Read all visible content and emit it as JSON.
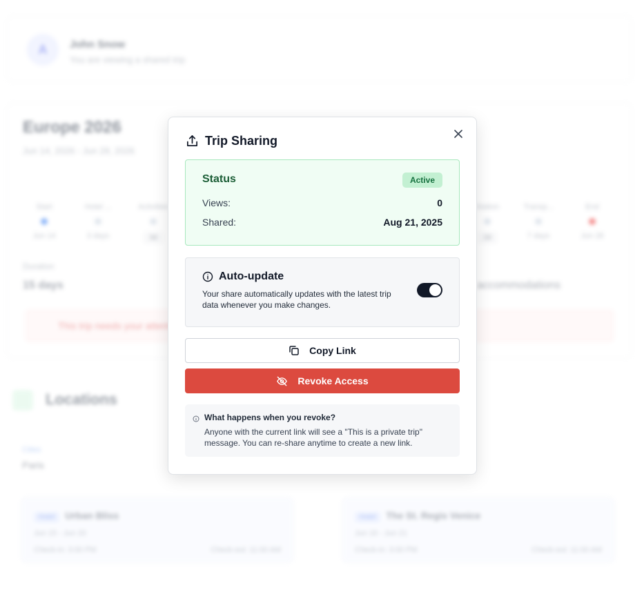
{
  "background": {
    "user": {
      "initial": "A",
      "name": "John Snow",
      "subtitle": "You are viewing a shared trip"
    },
    "trip": {
      "title": "Europe 2026",
      "dates": "Jun 14, 2026 - Jun 28, 2026",
      "timeline": [
        {
          "label": "Start",
          "sub": "Jun 14",
          "color": "#3b82f6"
        },
        {
          "label": "Hotel ...",
          "sub": "3 days",
          "color": "#cbd5e1"
        },
        {
          "label": "Activities",
          "sub": "3d",
          "color": "#cbd5e1"
        },
        {
          "label": "Station",
          "sub": "2d",
          "color": "#cbd5e1"
        },
        {
          "label": "Transp...",
          "sub": "7 days",
          "color": "#cbd5e1"
        },
        {
          "label": "End",
          "sub": "Jun 28",
          "color": "#ef4444"
        }
      ],
      "duration_label": "Duration",
      "duration_value": "15 days",
      "accommodations_text": "accommodations",
      "warning": "This trip needs your attention"
    },
    "locations": {
      "title": "Locations",
      "city_label": "Cities",
      "city_name": "Paris",
      "stays": [
        {
          "tag": "Hotel",
          "name": "Urban Bliss",
          "dates": "Jun 15 - Jun 20",
          "checkin": "Check-in: 3:00 PM",
          "checkout": "Check-out: 11:00 AM"
        },
        {
          "tag": "Hotel",
          "name": "The St. Regis Venice",
          "dates": "Jun 16 - Jun 21",
          "checkin": "Check-in: 3:00 PM",
          "checkout": "Check-out: 11:00 AM"
        }
      ]
    }
  },
  "modal": {
    "title": "Trip Sharing",
    "title_icon": "share-icon",
    "close_icon": "close-icon",
    "status": {
      "title": "Status",
      "badge": "Active",
      "views_label": "Views:",
      "views_value": "0",
      "shared_label": "Shared:",
      "shared_value": "Aug 21, 2025"
    },
    "auto_update": {
      "title": "Auto-update",
      "icon": "info-icon",
      "description": "Your share automatically updates with the latest trip data whenever you make changes.",
      "enabled": true
    },
    "copy_button": {
      "label": "Copy Link",
      "icon": "copy-icon"
    },
    "revoke_button": {
      "label": "Revoke Access",
      "icon": "eye-off-icon"
    },
    "revoke_info": {
      "title": "What happens when you revoke?",
      "text": "Anyone with the current link will see a \"This is a private trip\" message. You can re-share anytime to create a new link.",
      "icon": "info-icon"
    }
  },
  "colors": {
    "status_bg": "#f0fdf4",
    "status_border": "#a7e8bd",
    "badge_bg": "#c3f0d2",
    "revoke": "#dc4a3f",
    "toggle_on": "#111827"
  }
}
